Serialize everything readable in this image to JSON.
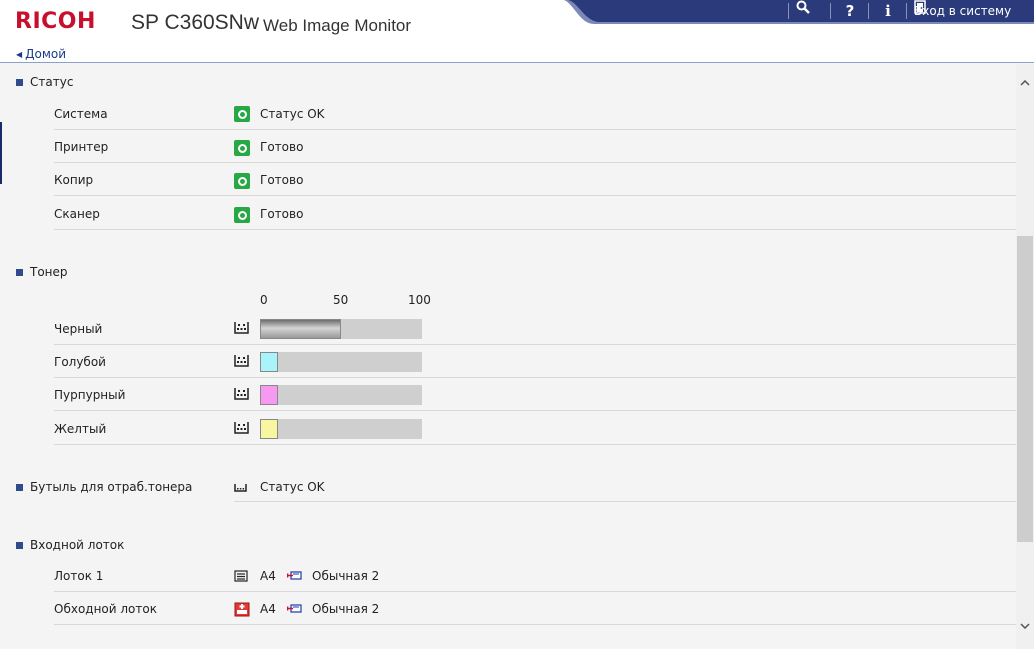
{
  "header": {
    "brand": "RICOH",
    "model": "SP C360SN",
    "model_suffix": "w",
    "app_title": "Web Image Monitor",
    "login_label": "Вход в систему"
  },
  "nav": {
    "home_label": "Домой"
  },
  "status_section": {
    "title": "Статус",
    "rows": [
      {
        "label": "Система",
        "value": "Статус OK"
      },
      {
        "label": "Принтер",
        "value": "Готово"
      },
      {
        "label": "Копир",
        "value": "Готово"
      },
      {
        "label": "Сканер",
        "value": "Готово"
      }
    ]
  },
  "toner_section": {
    "title": "Тонер",
    "scale": [
      "0",
      "50",
      "100"
    ],
    "rows": [
      {
        "label": "Черный",
        "level": 0.5,
        "color": "#9a9a9a"
      },
      {
        "label": "Голубой",
        "level": 0.1,
        "color": "#a8f4fa"
      },
      {
        "label": "Пурпурный",
        "level": 0.1,
        "color": "#f59af0"
      },
      {
        "label": "Желтый",
        "level": 0.1,
        "color": "#f8f6a0"
      }
    ]
  },
  "waste_section": {
    "title": "Бутыль для отраб.тонера",
    "value": "Статус OK"
  },
  "tray_section": {
    "title": "Входной лоток",
    "rows": [
      {
        "label": "Лоток 1",
        "size": "A4",
        "type": "Обычная 2",
        "icon": "tray-icon"
      },
      {
        "label": "Обходной лоток",
        "size": "A4",
        "type": "Обычная 2",
        "icon": "bypass-tray-icon"
      }
    ]
  },
  "colors": {
    "brand": "#c8102e",
    "accent": "#2f4b8c",
    "ok": "#28a745"
  }
}
